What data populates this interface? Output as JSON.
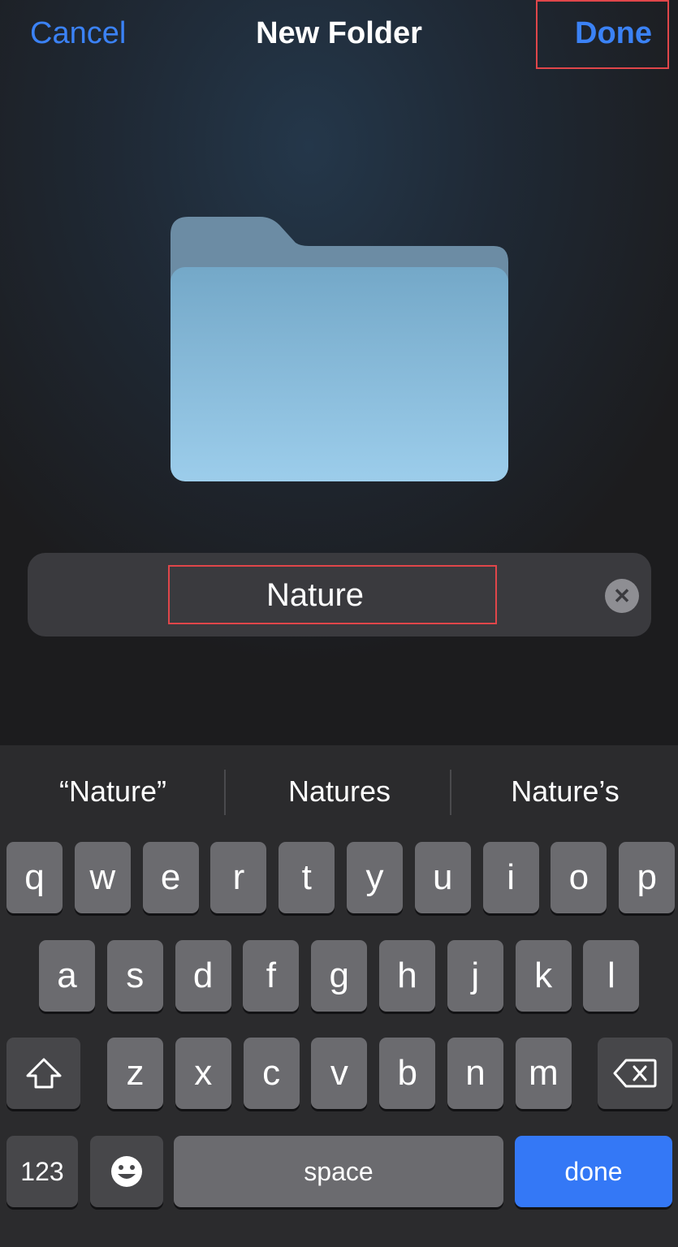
{
  "header": {
    "cancel_label": "Cancel",
    "title": "New Folder",
    "done_label": "Done"
  },
  "folder": {
    "icon": "folder-icon"
  },
  "name_field": {
    "value": "Nature",
    "clear_icon": "clear-circle-icon"
  },
  "suggestions": [
    "“Nature”",
    "Natures",
    "Nature’s"
  ],
  "keyboard": {
    "row1": [
      "q",
      "w",
      "e",
      "r",
      "t",
      "y",
      "u",
      "i",
      "o",
      "p"
    ],
    "row2": [
      "a",
      "s",
      "d",
      "f",
      "g",
      "h",
      "j",
      "k",
      "l"
    ],
    "row3": [
      "z",
      "x",
      "c",
      "v",
      "b",
      "n",
      "m"
    ],
    "numbers_label": "123",
    "space_label": "space",
    "done_label": "done",
    "shift_icon": "shift-icon",
    "delete_icon": "delete-backspace-icon",
    "emoji_icon": "emoji-icon"
  },
  "colors": {
    "accent": "#3b82f6",
    "done_key": "#3478f6",
    "highlight": "#e0464a"
  }
}
